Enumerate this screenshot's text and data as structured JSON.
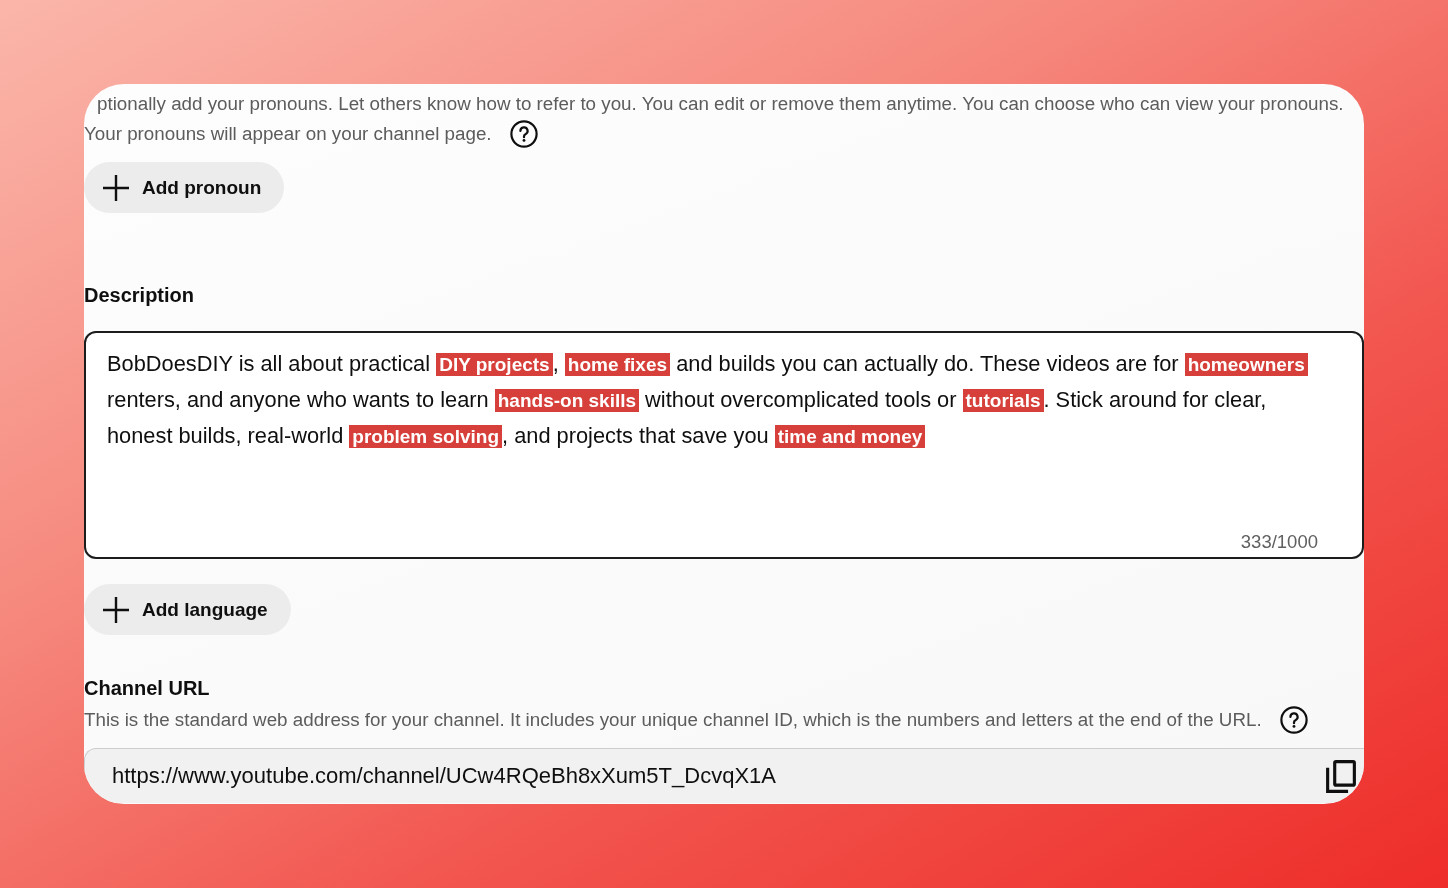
{
  "pronouns": {
    "help_text": "ptionally add your pronouns. Let others know how to refer to you. You can edit or remove them anytime. You can choose who can view your pronouns.",
    "visibility_note": "Your pronouns will appear on your channel page.",
    "add_button": {
      "label": "Add pronoun"
    }
  },
  "description": {
    "label": "Description",
    "value": "BobDoesDIY is all about practical **DIY projects**, **home fixes** and builds you can actually do. These videos are for **homeowners** renters, and anyone who wants to learn **hands-on skills** without overcomplicated tools or **tutorials**. Stick around for clear, honest builds, real-world **problem solving**, and projects that save you **time and money**",
    "counter": "333/1000"
  },
  "add_language_button": {
    "label": "Add language"
  },
  "channel_url": {
    "label": "Channel URL",
    "help_text": "This is the standard web address for your channel. It includes your unique channel ID, which is the numbers and letters at the end of the URL.",
    "value": "https://www.youtube.com/channel/UCw4RQeBh8xXum5T_DcvqX1A"
  }
}
